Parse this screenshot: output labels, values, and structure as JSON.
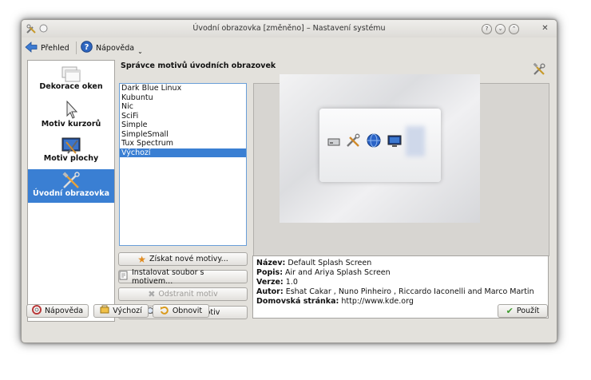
{
  "window": {
    "title": "Úvodní obrazovka [změněno] – Nastavení systému"
  },
  "toolbar": {
    "overview_label": "Přehled",
    "help_label": "Nápověda"
  },
  "sidebar": {
    "items": [
      {
        "label": "Dekorace oken",
        "icon": "window-decoration-icon"
      },
      {
        "label": "Motiv kurzorů",
        "icon": "cursor-icon"
      },
      {
        "label": "Motiv plochy",
        "icon": "desktop-theme-icon"
      },
      {
        "label": "Úvodní obrazovka",
        "icon": "splash-screen-icon",
        "selected": true
      }
    ]
  },
  "main": {
    "heading": "Správce motivů úvodních obrazovek",
    "themes": [
      "Dark Blue Linux",
      "Kubuntu",
      "Nic",
      "SciFi",
      "Simple",
      "SimpleSmall",
      "Tux Spectrum",
      "Výchozí"
    ],
    "selected_theme": "Výchozí",
    "actions": {
      "get_new": "Získat nové motivy...",
      "install": "Instalovat soubor s motivem...",
      "remove": "Odstranit motiv",
      "test": "Otestovat motiv"
    },
    "info": {
      "name_label": "Název:",
      "name_value": "Default Splash Screen",
      "desc_label": "Popis:",
      "desc_value": "Air and Ariya Splash Screen",
      "version_label": "Verze:",
      "version_value": "1.0",
      "author_label": "Autor:",
      "author_value": "Eshat Cakar , Nuno Pinheiro , Riccardo Iaconelli and Marco Martin",
      "homepage_label": "Domovská stránka:",
      "homepage_value": "http://www.kde.org"
    }
  },
  "bottom": {
    "help": "Nápověda",
    "defaults": "Výchozí",
    "reset": "Obnovit",
    "apply": "Použít"
  },
  "colors": {
    "selection": "#3a7fd3",
    "window_bg": "#e3e1dc"
  }
}
